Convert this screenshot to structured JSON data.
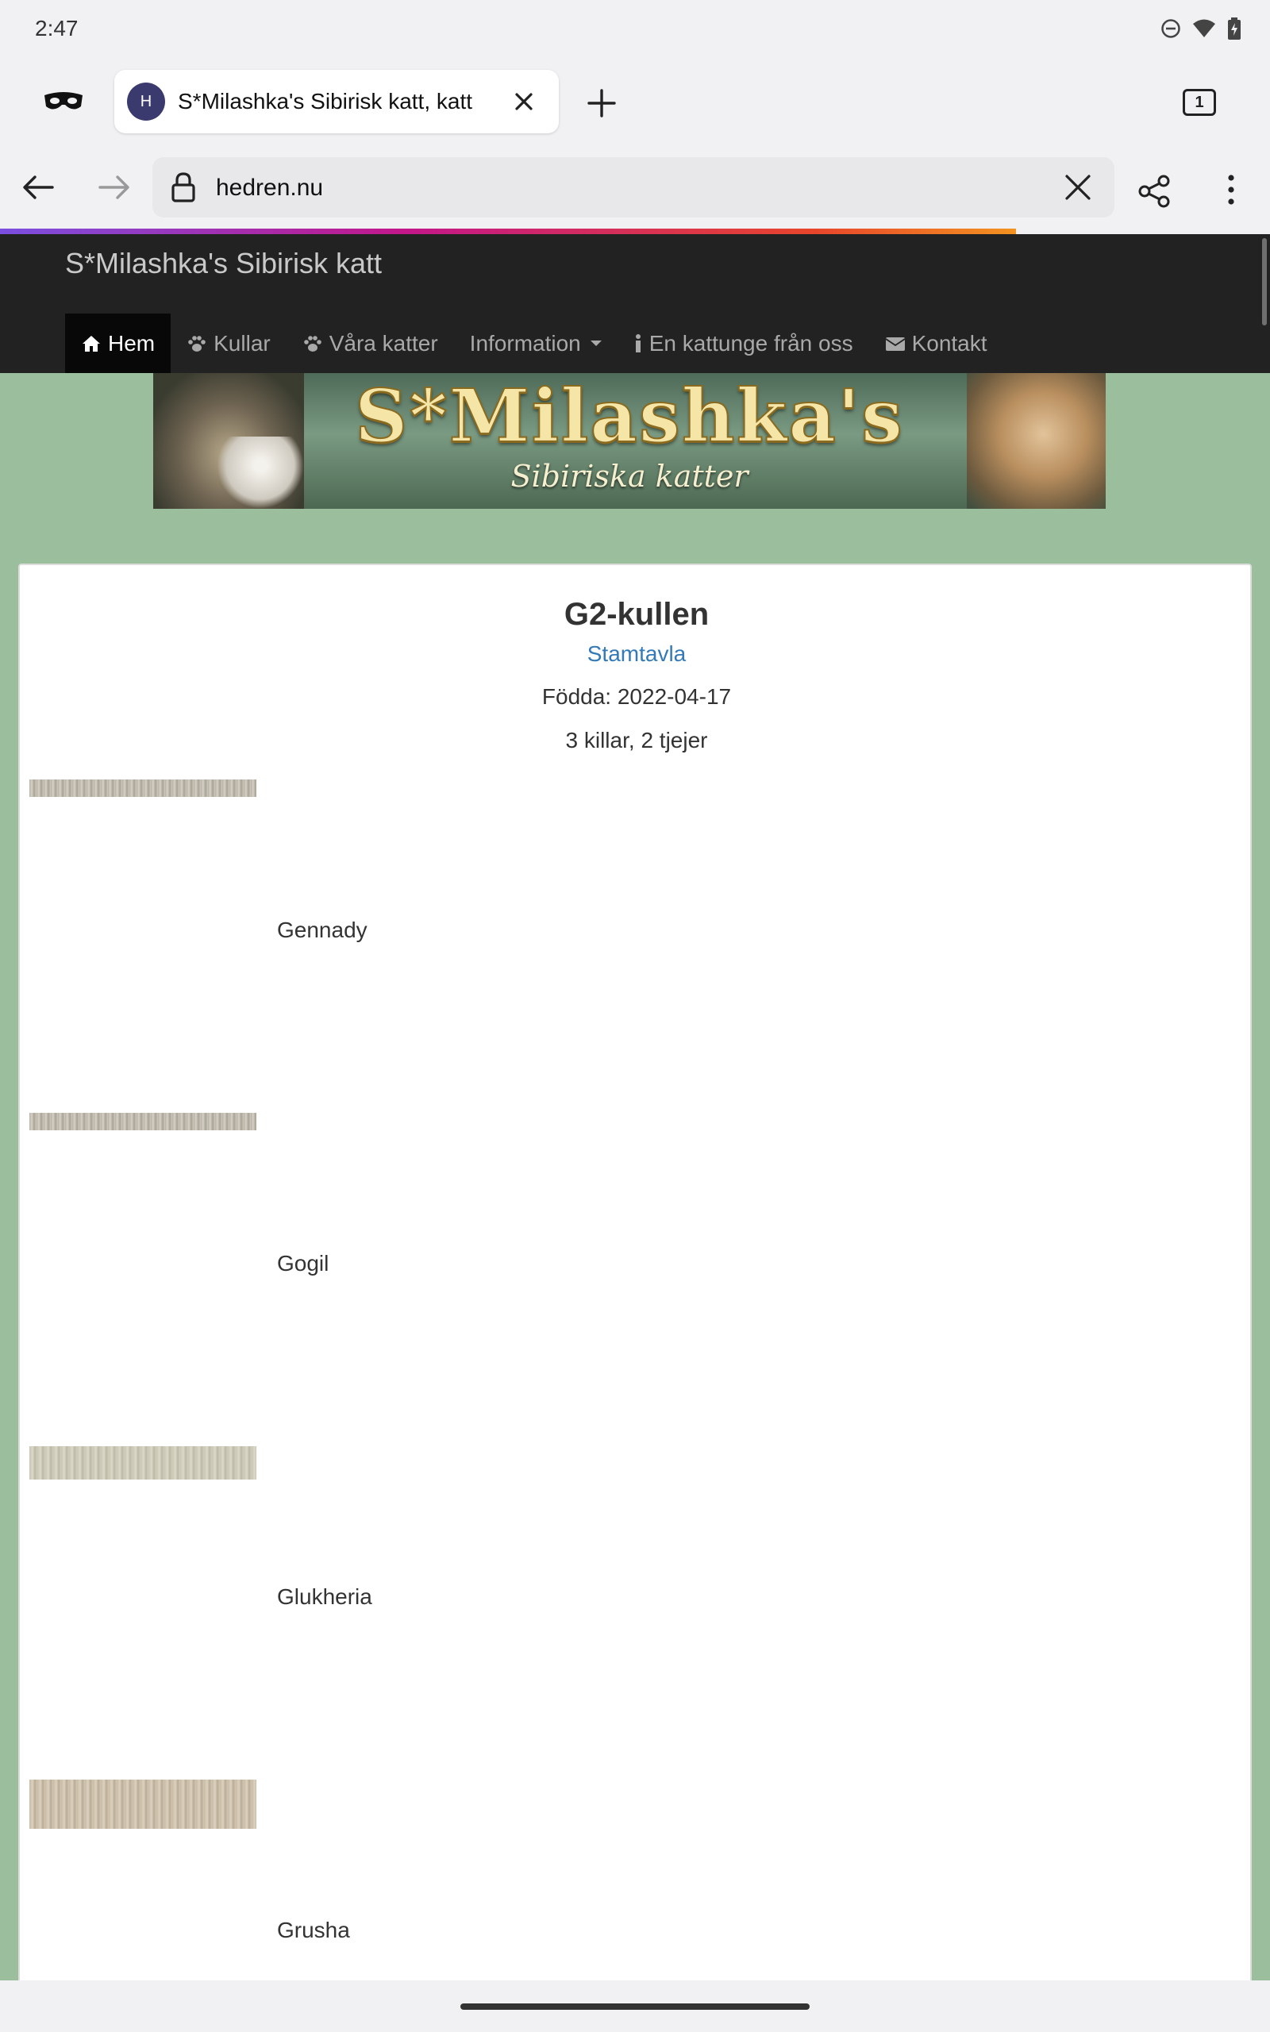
{
  "status_bar": {
    "time": "2:47",
    "icons": [
      "do-not-disturb-icon",
      "wifi-icon",
      "battery-charging-icon"
    ]
  },
  "tab": {
    "favicon_letter": "H",
    "title": "S*Milashka's Sibirisk katt, katt",
    "tab_count": "1"
  },
  "address_bar": {
    "url": "hedren.nu"
  },
  "site": {
    "brand": "S*Milashka's Sibirisk katt",
    "nav": [
      {
        "label": "Hem",
        "icon": "home-icon"
      },
      {
        "label": "Kullar",
        "icon": "paw-icon"
      },
      {
        "label": "Våra katter",
        "icon": "paw-icon"
      },
      {
        "label": "Information",
        "icon": "caret-down-icon"
      },
      {
        "label": "En kattunge från oss",
        "icon": "info-icon"
      },
      {
        "label": "Kontakt",
        "icon": "envelope-icon"
      }
    ],
    "banner": {
      "logo_text": "S*Milashka's",
      "subtitle": "Sibiriska katter"
    }
  },
  "litter": {
    "title": "G2-kullen",
    "pedigree_link": "Stamtavla",
    "born": "Födda: 2022-04-17",
    "count": "3 killar, 2 tjejer",
    "kittens": [
      {
        "name": "Gennady"
      },
      {
        "name": "Gogil"
      },
      {
        "name": "Glukheria"
      },
      {
        "name": "Grusha"
      }
    ]
  },
  "colors": {
    "navbar": "#222222",
    "page_background": "#9bbf9d",
    "link": "#337ab7"
  }
}
